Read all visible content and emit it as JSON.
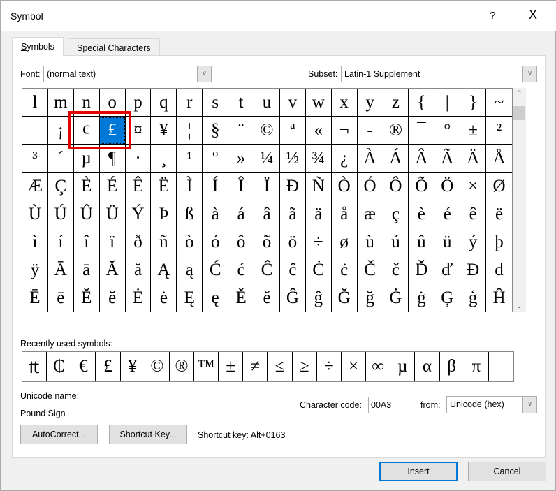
{
  "window": {
    "title": "Symbol",
    "help": "?",
    "close": "X"
  },
  "tabs": [
    {
      "label": "Symbols",
      "mnemonic": "S",
      "rest": "ymbols"
    },
    {
      "label": "Special Characters",
      "pre": "S",
      "mnemonic": "p",
      "rest": "ecial Characters"
    }
  ],
  "font": {
    "label": "Font:",
    "value": "(normal text)"
  },
  "subset": {
    "label": "Subset:",
    "value": "Latin-1 Supplement"
  },
  "grid": {
    "selected": {
      "row": 1,
      "col": 3
    },
    "rows": [
      [
        "l",
        "m",
        "n",
        "o",
        "p",
        "q",
        "r",
        "s",
        "t",
        "u",
        "v",
        "w",
        "x",
        "y",
        "z",
        "{",
        "|",
        "}",
        "~"
      ],
      [
        " ",
        "¡",
        "¢",
        "£",
        "¤",
        "¥",
        "¦",
        "§",
        "¨",
        "©",
        "ª",
        "«",
        "¬",
        "-",
        "®",
        "¯",
        "°",
        "±",
        "²"
      ],
      [
        "³",
        "´",
        "µ",
        "¶",
        "·",
        "¸",
        "¹",
        "º",
        "»",
        "¼",
        "½",
        "¾",
        "¿",
        "À",
        "Á",
        "Â",
        "Ã",
        "Ä",
        "Å"
      ],
      [
        "Æ",
        "Ç",
        "È",
        "É",
        "Ê",
        "Ë",
        "Ì",
        "Í",
        "Î",
        "Ï",
        "Ð",
        "Ñ",
        "Ò",
        "Ó",
        "Ô",
        "Õ",
        "Ö",
        "×",
        "Ø"
      ],
      [
        "Ù",
        "Ú",
        "Û",
        "Ü",
        "Ý",
        "Þ",
        "ß",
        "à",
        "á",
        "â",
        "ã",
        "ä",
        "å",
        "æ",
        "ç",
        "è",
        "é",
        "ê",
        "ë"
      ],
      [
        "ì",
        "í",
        "î",
        "ï",
        "ð",
        "ñ",
        "ò",
        "ó",
        "ô",
        "õ",
        "ö",
        "÷",
        "ø",
        "ù",
        "ú",
        "û",
        "ü",
        "ý",
        "þ"
      ],
      [
        "ÿ",
        "Ā",
        "ā",
        "Ă",
        "ă",
        "Ą",
        "ą",
        "Ć",
        "ć",
        "Ĉ",
        "ĉ",
        "Ċ",
        "ċ",
        "Č",
        "č",
        "Ď",
        "ď",
        "Đ",
        "đ"
      ],
      [
        "Ē",
        "ē",
        "Ĕ",
        "ĕ",
        "Ė",
        "ė",
        "Ę",
        "ę",
        "Ě",
        "ě",
        "Ĝ",
        "ĝ",
        "Ğ",
        "ğ",
        "Ġ",
        "ġ",
        "Ģ",
        "ģ",
        "Ĥ"
      ]
    ]
  },
  "recent": {
    "label": "Recently used symbols:",
    "symbols": [
      "₶",
      "₵",
      "€",
      "£",
      "¥",
      "©",
      "®",
      "™",
      "±",
      "≠",
      "≤",
      "≥",
      "÷",
      "×",
      "∞",
      "µ",
      "α",
      "β",
      "π"
    ]
  },
  "unicode_name": {
    "label": "Unicode name:",
    "value": "Pound Sign"
  },
  "character_code": {
    "label": "Character code:",
    "value": "00A3"
  },
  "from": {
    "label": "from:",
    "value": "Unicode (hex)"
  },
  "buttons": {
    "autocorrect": "AutoCorrect...",
    "shortcut_key": "Shortcut Key...",
    "insert": "Insert",
    "cancel": "Cancel"
  },
  "shortcut": {
    "text": "Shortcut key: Alt+0163"
  },
  "colors": {
    "selection": "#0078d7",
    "annotation": "#e50000"
  }
}
